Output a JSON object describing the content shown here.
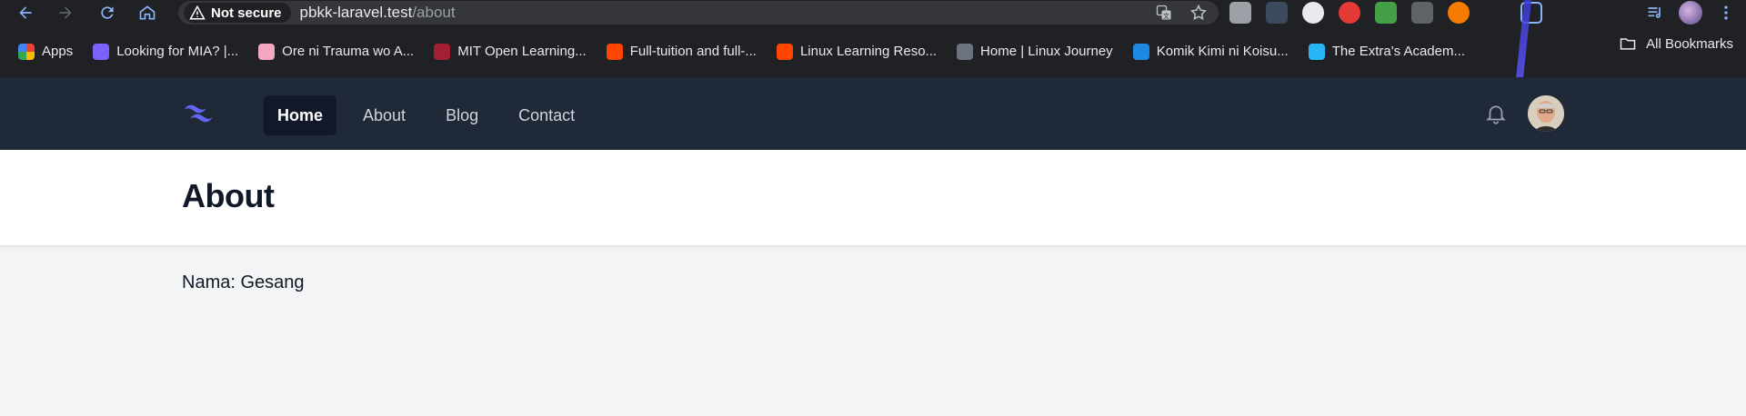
{
  "browser": {
    "security_label": "Not secure",
    "url_host": "pbkk-laravel.test",
    "url_path": "/about",
    "all_bookmarks_label": "All Bookmarks"
  },
  "bookmarks": [
    {
      "label": "Apps",
      "icon": "apps-grid-icon",
      "color": "#4285f4"
    },
    {
      "label": "Looking for MIA? |...",
      "icon": "bird-favicon",
      "color": "#7b61ff"
    },
    {
      "label": "Ore ni Trauma wo A...",
      "icon": "flower-favicon",
      "color": "#f4a7c3"
    },
    {
      "label": "MIT Open Learning...",
      "icon": "mit-favicon",
      "color": "#a31f34"
    },
    {
      "label": "Full-tuition and full-...",
      "icon": "reddit-favicon",
      "color": "#ff4500"
    },
    {
      "label": "Linux Learning Reso...",
      "icon": "reddit-favicon",
      "color": "#ff4500"
    },
    {
      "label": "Home | Linux Journey",
      "icon": "penguin-favicon",
      "color": "#6b7280"
    },
    {
      "label": "Komik Kimi ni Koisu...",
      "icon": "k-favicon",
      "color": "#1e88e5"
    },
    {
      "label": "The Extra's Academ...",
      "icon": "nt-favicon",
      "color": "#29b6f6"
    }
  ],
  "app": {
    "nav": [
      {
        "label": "Home",
        "active": true
      },
      {
        "label": "About",
        "active": false
      },
      {
        "label": "Blog",
        "active": false
      },
      {
        "label": "Contact",
        "active": false
      }
    ],
    "page_title": "About",
    "content_text": "Nama: Gesang"
  },
  "colors": {
    "nav_bg": "#1f2937",
    "accent": "#6366f1",
    "page_bg": "#f3f4f6"
  }
}
